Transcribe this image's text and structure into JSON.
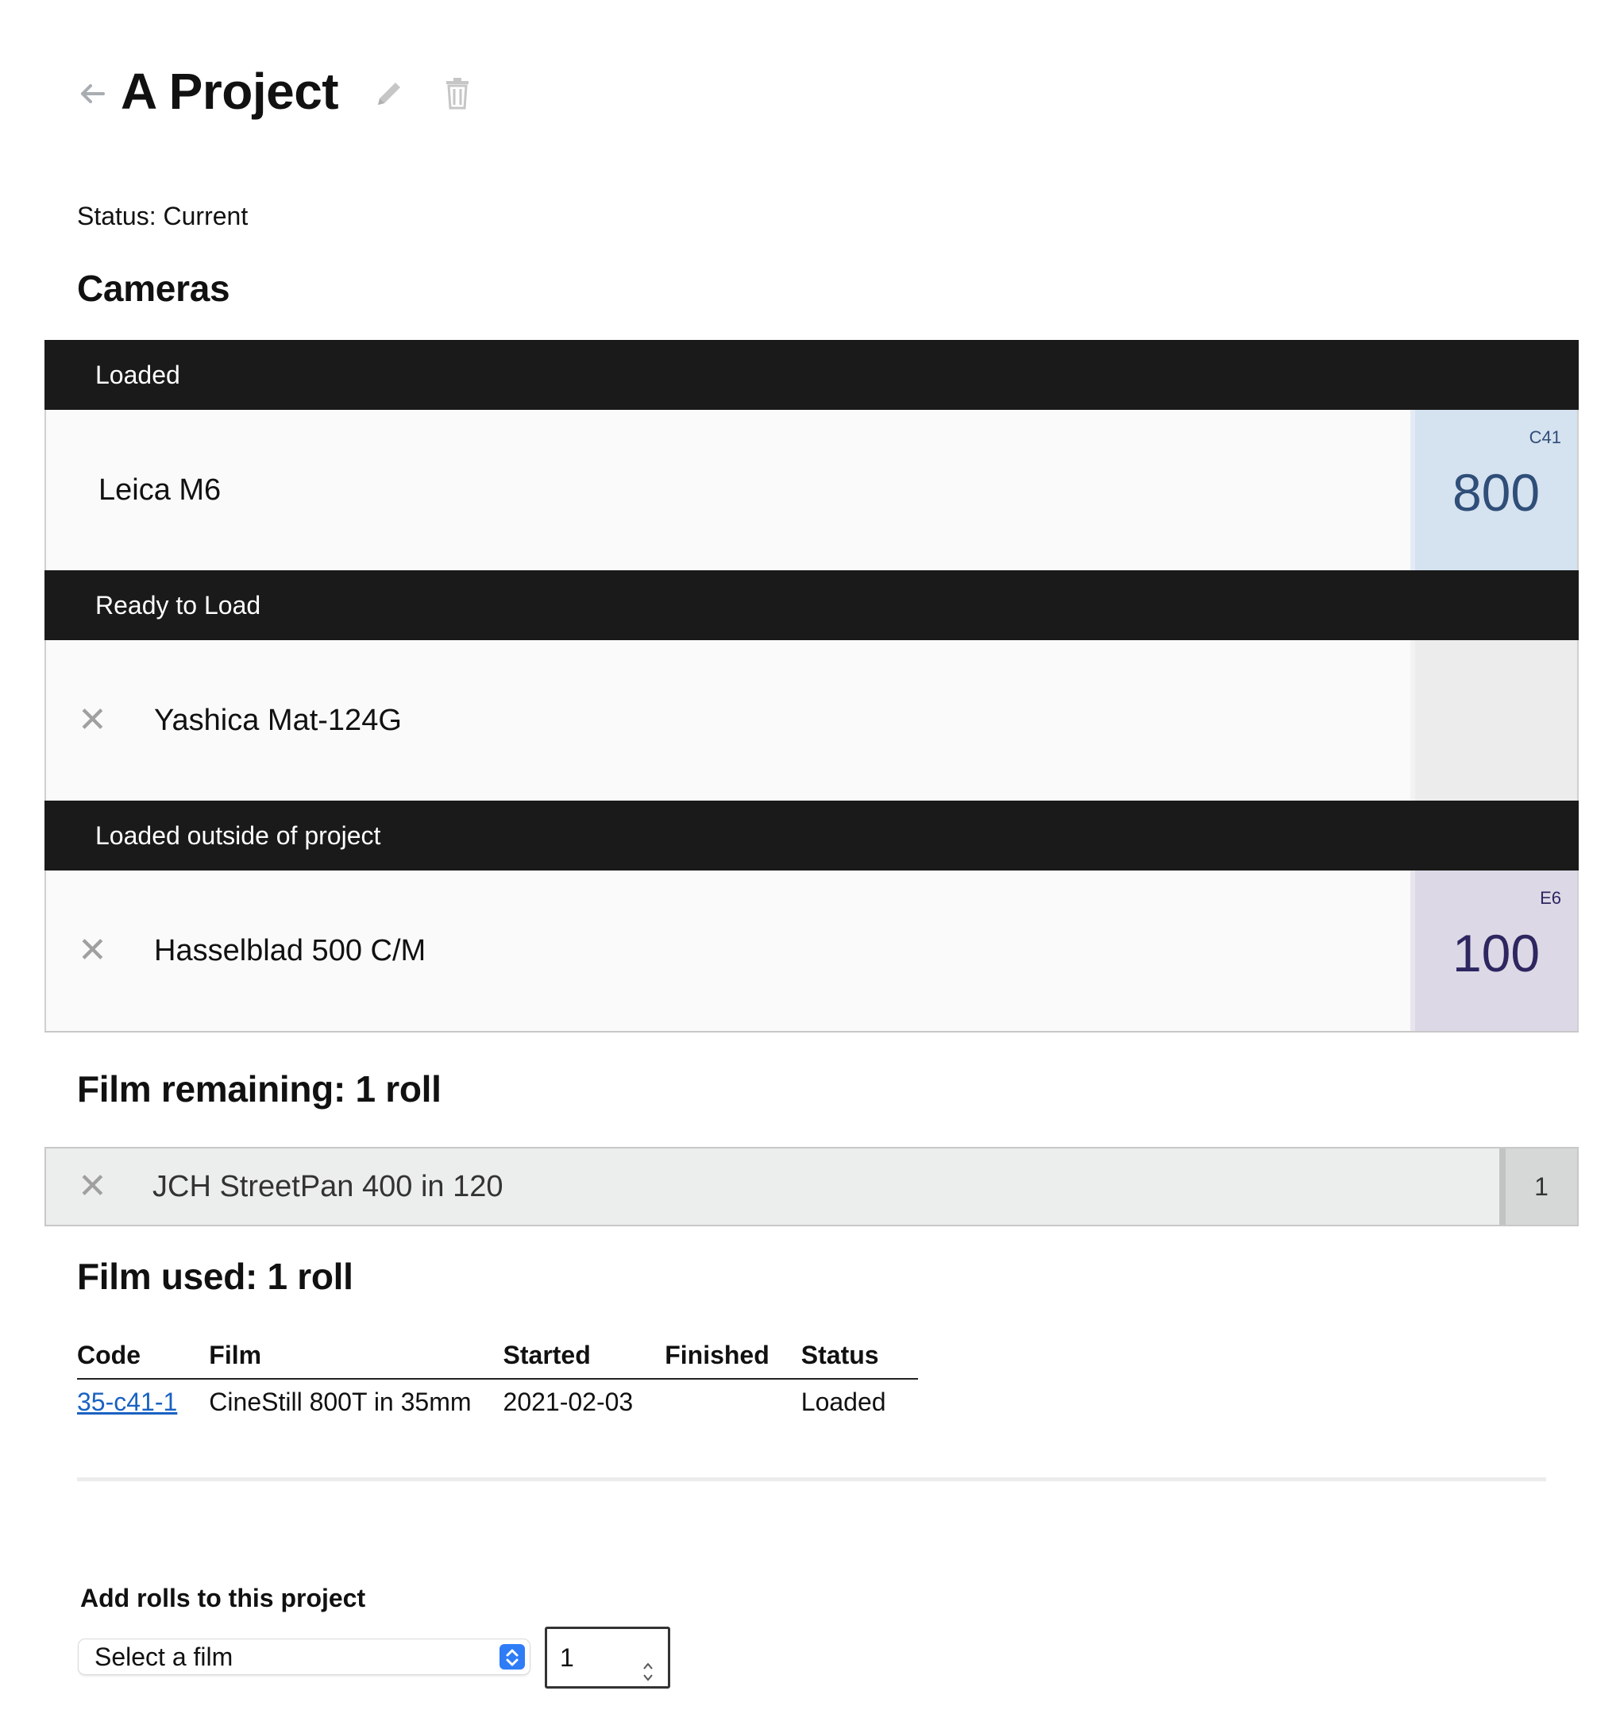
{
  "header": {
    "title": "A Project",
    "back_icon": "arrow-left-icon",
    "edit_icon": "pencil-icon",
    "delete_icon": "trash-icon"
  },
  "status_text": "Status: Current",
  "cameras": {
    "heading": "Cameras",
    "groups": [
      {
        "label": "Loaded",
        "items": [
          {
            "name": "Leica M6",
            "removable": false,
            "film": {
              "process": "C41",
              "iso": "800",
              "bg": "#d5e2ef",
              "fg": "#2f4e78"
            }
          }
        ]
      },
      {
        "label": "Ready to Load",
        "items": [
          {
            "name": "Yashica Mat-124G",
            "removable": true,
            "film": null
          }
        ]
      },
      {
        "label": "Loaded outside of project",
        "items": [
          {
            "name": "Hasselblad 500 C/M",
            "removable": true,
            "film": {
              "process": "E6",
              "iso": "100",
              "bg": "#dcd8e6",
              "fg": "#2d2660"
            }
          }
        ]
      }
    ],
    "empty_film_bg": "#ececec"
  },
  "film_remaining": {
    "heading": "Film remaining: 1 roll",
    "items": [
      {
        "name": "JCH StreetPan 400 in 120",
        "count": "1"
      }
    ]
  },
  "film_used": {
    "heading": "Film used: 1 roll",
    "columns": [
      "Code",
      "Film",
      "Started",
      "Finished",
      "Status"
    ],
    "rows": [
      {
        "code": "35-c41-1",
        "film": "CineStill 800T in 35mm",
        "started": "2021-02-03",
        "finished": "",
        "status": "Loaded"
      }
    ]
  },
  "add_rolls": {
    "label": "Add rolls to this project",
    "select_value": "Select a film",
    "quantity": "1"
  },
  "colors": {
    "header_bg": "#1a1a1a",
    "link": "#1a62c2"
  }
}
